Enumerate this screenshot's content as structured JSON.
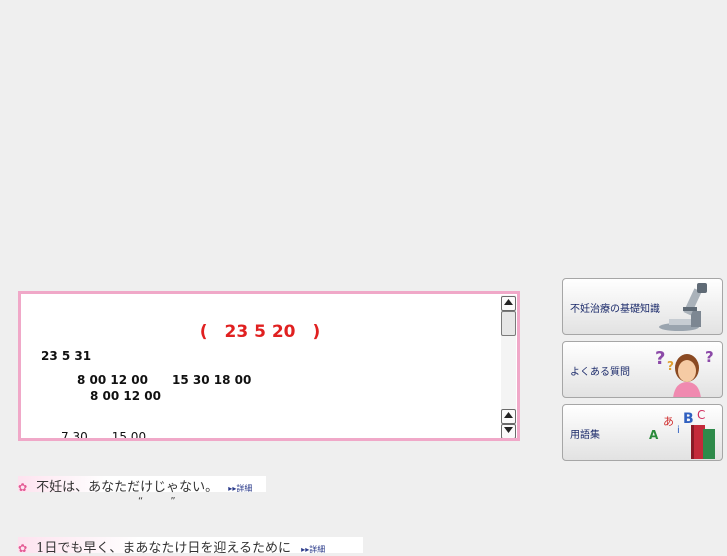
{
  "news": {
    "title": "(　23 5 20　)",
    "lines": [
      "23 5 31",
      "8 00 12 00　　15 30 18 00",
      "8 00 12 00",
      "7 30　　15 00"
    ],
    "scroll_up_icon": "triangle-up",
    "scroll_down_icon": "triangle-down"
  },
  "side_menu": [
    {
      "label": "不妊治療の基礎知識",
      "icon": "microscope-icon"
    },
    {
      "label": "よくある質問",
      "icon": "question-woman-icon"
    },
    {
      "label": "用語集",
      "icon": "books-letters-icon"
    }
  ],
  "banners": [
    {
      "text": "不妊は、あなただけじゃない。",
      "more": "▸▸詳細"
    },
    {
      "text": "1日でも早く、まあなたけ日を迎えるために",
      "more": "▸▸詳細"
    }
  ],
  "quote_marks": "“ ”",
  "colors": {
    "accent_pink": "#f0a8c8",
    "title_red": "#e02020",
    "link_navy": "#1b2a6a"
  }
}
